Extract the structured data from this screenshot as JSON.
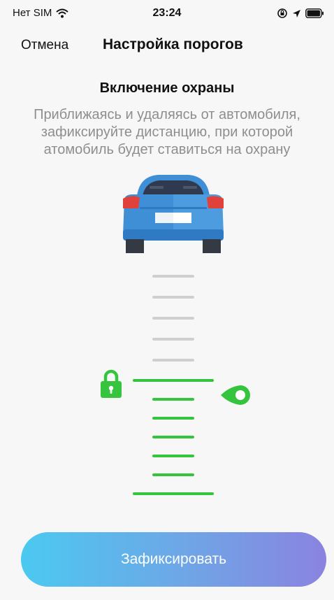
{
  "status_bar": {
    "carrier": "Нет SIM",
    "time": "23:24"
  },
  "nav": {
    "cancel_label": "Отмена",
    "title": "Настройка порогов"
  },
  "content": {
    "heading": "Включение охраны",
    "description": "Приближаясь и удаляясь от автомобиля, зафиксируйте дистанцию, при которой атомобиль будет ставиться на охрану"
  },
  "scale": {
    "gray_ticks": 5,
    "green_ticks": 7
  },
  "colors": {
    "accent_green": "#35c43e",
    "button_start": "#4bc9f1",
    "button_end": "#8a83e0",
    "car_body": "#3f8fd6"
  },
  "icons": [
    "wifi-icon",
    "rotation-lock-icon",
    "location-arrow-icon",
    "battery-icon",
    "car-icon",
    "lock-icon",
    "location-pin-icon"
  ],
  "action": {
    "fix_label": "Зафиксировать"
  }
}
